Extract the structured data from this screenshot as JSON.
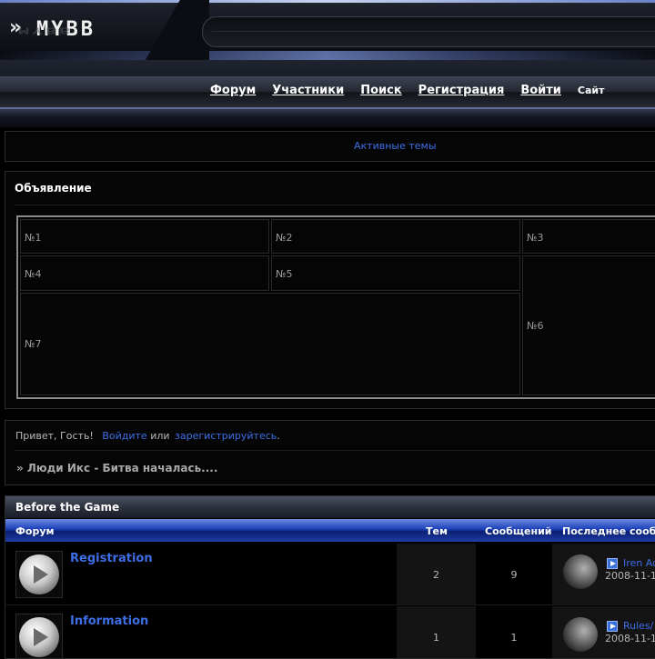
{
  "header": {
    "logo_text": "MYBB",
    "logo_chevrons": "»",
    "nav": [
      {
        "label": "Форум"
      },
      {
        "label": "Участники"
      },
      {
        "label": "Поиск"
      },
      {
        "label": "Регистрация"
      },
      {
        "label": "Войти"
      },
      {
        "label": "Сайт"
      }
    ]
  },
  "active_topics": {
    "label": "Активные темы"
  },
  "announcement": {
    "title": "Объявление",
    "cells": [
      "№1",
      "№2",
      "№3",
      "№4",
      "№5",
      "№6",
      "№7"
    ]
  },
  "welcome": {
    "greeting": "Привет, Гость!",
    "login_link": "Войдите",
    "or_text": "или",
    "register_link": "зарегистрируйтесь",
    "period": ".",
    "breadcrumb": "» Люди Икс - Битва началась...."
  },
  "forum_table": {
    "category": "Before the Game",
    "columns": {
      "forum": "Форум",
      "topics": "Тем",
      "posts": "Сообщений",
      "last_post": "Последнее сооб"
    },
    "rows": [
      {
        "name": "Registration",
        "topics": "2",
        "posts": "9",
        "last_link": "Iren Ad",
        "last_date": "2008-11-1"
      },
      {
        "name": "Information",
        "topics": "1",
        "posts": "1",
        "last_link": "Rules/",
        "last_date": "2008-11-1"
      }
    ]
  },
  "colors": {
    "link": "#3d6ee6",
    "column_header": "#1b3fb8",
    "background": "#000000"
  }
}
